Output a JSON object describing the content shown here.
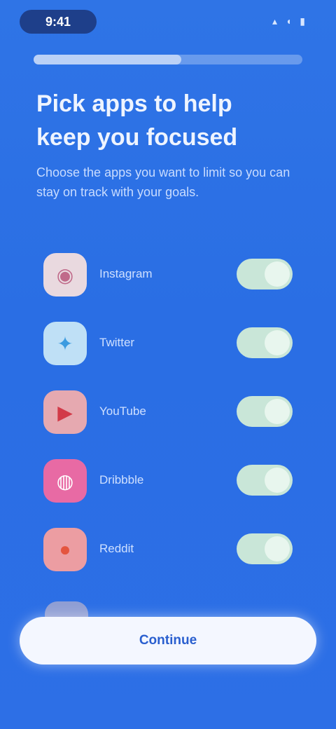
{
  "status_bar": {
    "time": "9:41",
    "icons": "▴ ◖ ▮"
  },
  "onboarding": {
    "progress": 0.55,
    "title": "Pick apps to help keep you focused",
    "subtitle": "Choose the apps you want to limit so you can stay on track with your goals."
  },
  "apps": [
    {
      "name": "Instagram",
      "icon": "camera-icon",
      "glyph": "◉",
      "bg": "#e9d9df",
      "fg": "#c06a8a",
      "enabled": true
    },
    {
      "name": "Twitter",
      "icon": "bird-icon",
      "glyph": "✦",
      "bg": "#bfe0f6",
      "fg": "#3b9be0",
      "enabled": true
    },
    {
      "name": "YouTube",
      "icon": "play-icon",
      "glyph": "▶",
      "bg": "#e6a9b0",
      "fg": "#d23a48",
      "enabled": true
    },
    {
      "name": "Dribbble",
      "icon": "ball-icon",
      "glyph": "◍",
      "bg": "#e86aa4",
      "fg": "#ffffff",
      "enabled": true
    },
    {
      "name": "Reddit",
      "icon": "alien-icon",
      "glyph": "●",
      "bg": "#ec9da2",
      "fg": "#e4553f",
      "enabled": true
    }
  ],
  "footer": {
    "continue_label": "Continue"
  }
}
